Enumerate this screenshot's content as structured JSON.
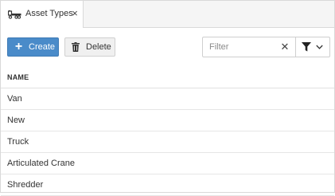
{
  "tab": {
    "icon": "truck-icon",
    "label": "Asset Types",
    "close_glyph": "×"
  },
  "toolbar": {
    "create_icon": "plus-icon",
    "create_label": "Create",
    "delete_icon": "trash-icon",
    "delete_label": "Delete"
  },
  "filter": {
    "placeholder": "Filter",
    "value": "",
    "clear_glyph": "✕",
    "menu_icon": "funnel-icon"
  },
  "table": {
    "column_header": "NAME",
    "rows": [
      "Van",
      "New",
      "Truck",
      "Articulated Crane",
      "Shredder"
    ]
  },
  "colors": {
    "primary": "#4a8bc9",
    "border": "#d9d9d9",
    "tabstrip_bg": "#f5f5f5"
  }
}
